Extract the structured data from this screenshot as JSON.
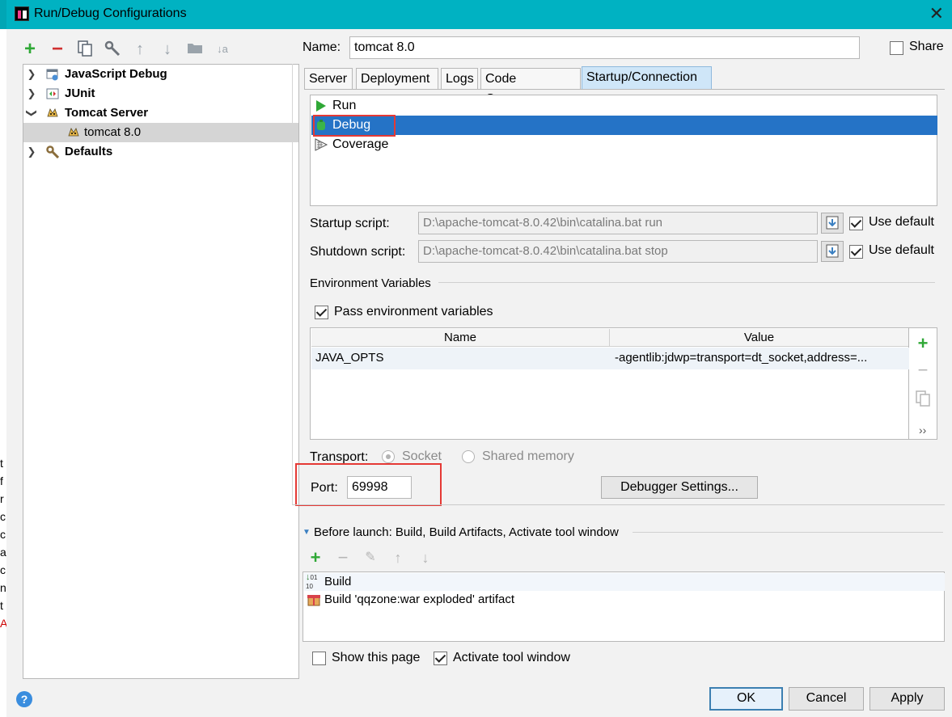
{
  "window": {
    "title": "Run/Debug Configurations"
  },
  "toolbar": {
    "add": "+",
    "remove": "−",
    "copy": "copy-icon",
    "edit_defaults": "wrench-icon",
    "move_up": "↑",
    "move_down": "↓",
    "folder": "folder-icon",
    "sort": "↓a z"
  },
  "tree": {
    "items": [
      {
        "label": "JavaScript Debug",
        "bold": true,
        "icon": "js-debug-icon"
      },
      {
        "label": "JUnit",
        "bold": true,
        "icon": "junit-icon"
      },
      {
        "label": "Tomcat Server",
        "bold": true,
        "icon": "tomcat-icon"
      },
      {
        "label": "tomcat 8.0",
        "bold": false,
        "icon": "tomcat-icon"
      },
      {
        "label": "Defaults",
        "bold": true,
        "icon": "wrench-icon"
      }
    ]
  },
  "form": {
    "name_label": "Name:",
    "name_value": "tomcat 8.0",
    "share_label": "Share"
  },
  "tabs": [
    "Server",
    "Deployment",
    "Logs",
    "Code Coverage",
    "Startup/Connection"
  ],
  "modes": [
    "Run",
    "Debug",
    "Coverage"
  ],
  "startup": {
    "startup_label": "Startup script:",
    "startup_value": "D:\\apache-tomcat-8.0.42\\bin\\catalina.bat run",
    "shutdown_label": "Shutdown script:",
    "shutdown_value": "D:\\apache-tomcat-8.0.42\\bin\\catalina.bat stop",
    "use_default": "Use default"
  },
  "env": {
    "section_label": "Environment Variables",
    "pass_label": "Pass environment variables",
    "col_name": "Name",
    "col_value": "Value",
    "rows": [
      {
        "name": "JAVA_OPTS",
        "value": "-agentlib:jdwp=transport=dt_socket,address=..."
      }
    ],
    "side_more": "››"
  },
  "transport": {
    "label": "Transport:",
    "socket": "Socket",
    "shared_memory": "Shared memory"
  },
  "port": {
    "label": "Port:",
    "value": "69998"
  },
  "debugger_settings": "Debugger Settings...",
  "before_launch": {
    "title": "Before launch: Build, Build Artifacts, Activate tool window",
    "items": [
      "Build",
      "Build 'qqzone:war exploded' artifact"
    ]
  },
  "options": {
    "show_page": "Show this page",
    "activate_tool": "Activate tool window"
  },
  "buttons": {
    "ok": "OK",
    "cancel": "Cancel",
    "apply": "Apply",
    "help": "?"
  },
  "colors": {
    "selection": "#2573c6",
    "accent": "#00b2c2",
    "highlight_box": "#e53935",
    "add_green": "#2fa836"
  },
  "background_fragments": [
    "t",
    "f",
    "r",
    "c",
    "c",
    "a",
    "c",
    "n",
    "t",
    "A"
  ]
}
